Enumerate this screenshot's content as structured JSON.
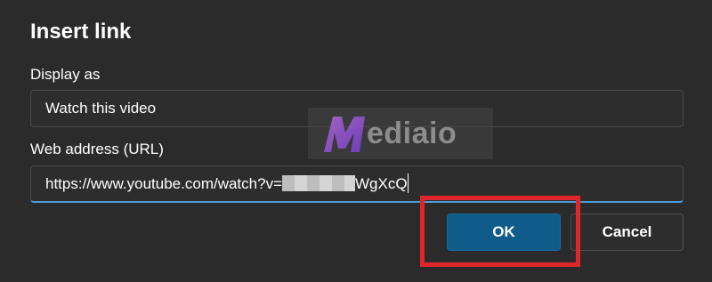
{
  "dialog": {
    "title": "Insert link",
    "display_as_label": "Display as",
    "display_as_value": "Watch this video",
    "url_label": "Web address (URL)",
    "url_value_prefix": "https://www.youtube.com/watch?v=",
    "url_value_suffix": "WgXcQ",
    "ok_label": "OK",
    "cancel_label": "Cancel"
  },
  "watermark": {
    "text": "ediaio",
    "logo_letter": "M"
  },
  "colors": {
    "dialog_bg": "#2b2b2b",
    "primary_button": "#0f5b8a",
    "focus_underline": "#4f9ed8",
    "highlight_box": "#e0262b"
  }
}
